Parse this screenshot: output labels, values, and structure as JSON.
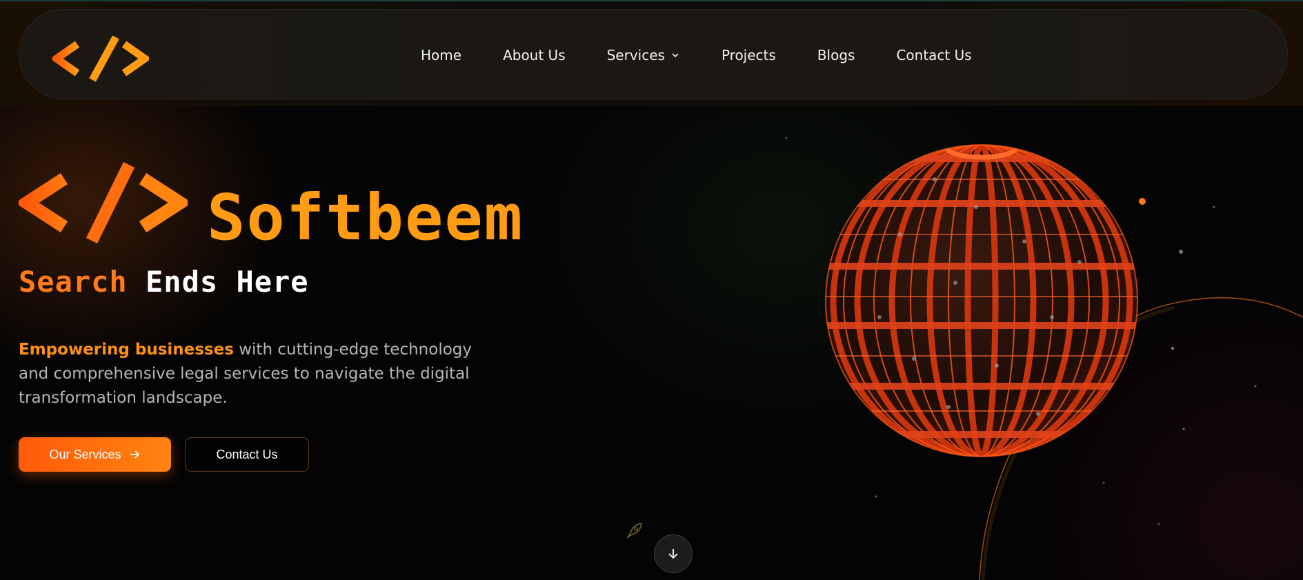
{
  "nav": {
    "logo_icon": "code-brackets-icon",
    "items": [
      {
        "label": "Home"
      },
      {
        "label": "About Us"
      },
      {
        "label": "Services",
        "has_dropdown": true
      },
      {
        "label": "Projects"
      },
      {
        "label": "Blogs"
      },
      {
        "label": "Contact Us"
      }
    ]
  },
  "hero": {
    "brand": "Softbeem",
    "tagline_part1": "Search",
    "tagline_part2": "Ends Here",
    "description_highlight": "Empowering businesses",
    "description_rest": " with cutting-edge technology and comprehensive legal services to navigate the digital transformation landscape.",
    "primary_button": "Our Services",
    "secondary_button": "Contact Us"
  },
  "colors": {
    "accent_orange": "#ff9c14",
    "accent_red_orange": "#ff5a0a",
    "background": "#040404"
  },
  "icons": {
    "arrow_right": "arrow-right-icon",
    "scroll_down": "arrow-down-icon",
    "rocket": "rocket-icon",
    "globe": "globe-illustration"
  }
}
